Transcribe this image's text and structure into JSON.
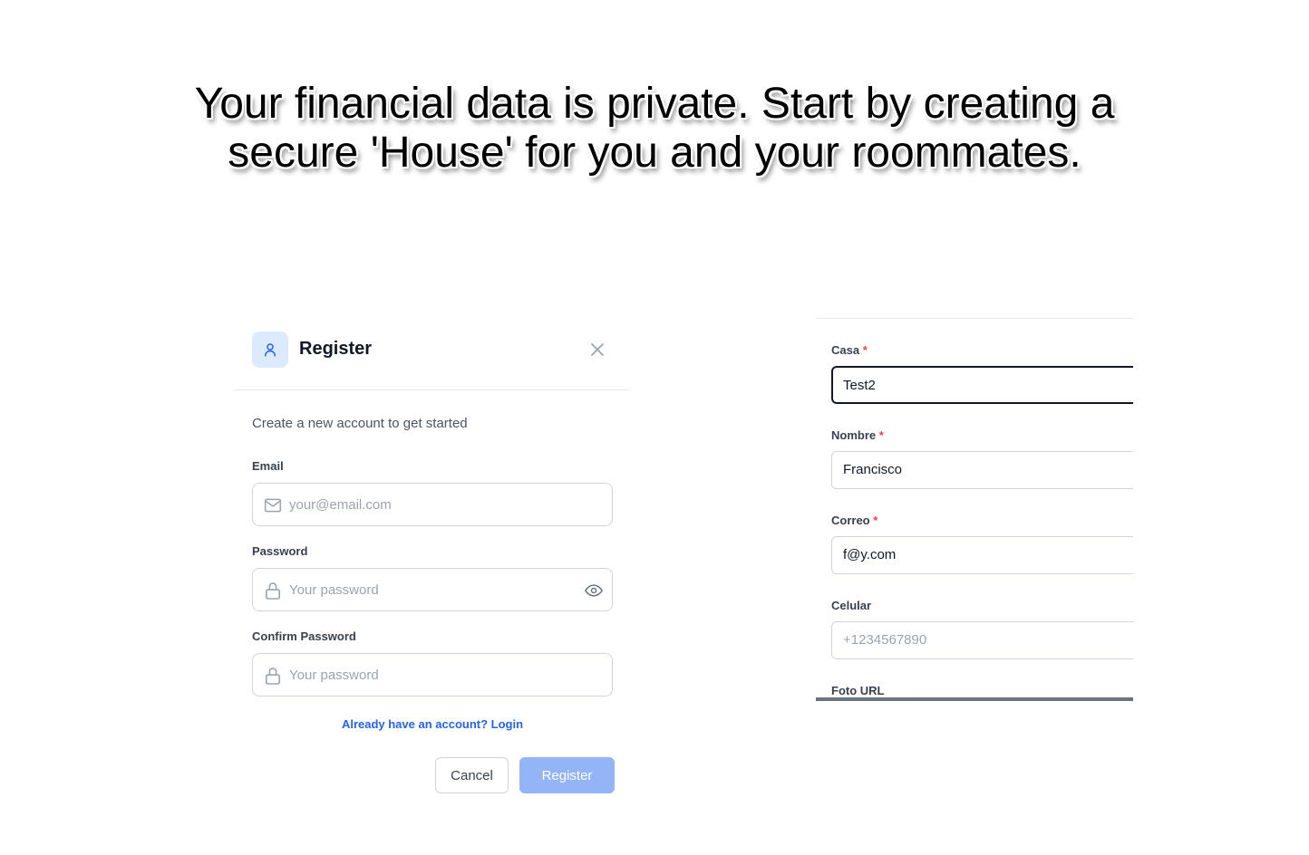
{
  "headline": {
    "line1": "Your financial data is private. Start by creating a",
    "line2": "secure 'House' for you and your roommates."
  },
  "register": {
    "title": "Register",
    "subtitle": "Create a new account to get started",
    "email_label": "Email",
    "email_placeholder": "your@email.com",
    "password_label": "Password",
    "password_placeholder": "Your password",
    "confirm_label": "Confirm Password",
    "confirm_placeholder": "Your password",
    "login_link": "Already have an account? Login",
    "cancel_label": "Cancel",
    "register_label": "Register"
  },
  "profile": {
    "casa_label": "Casa",
    "casa_value": "Test2",
    "nombre_label": "Nombre",
    "nombre_value": "Francisco",
    "correo_label": "Correo",
    "correo_value": "f@y.com",
    "celular_label": "Celular",
    "celular_placeholder": "+1234567890",
    "foto_label": "Foto URL",
    "required_mark": "*"
  },
  "colors": {
    "accent": "#2563eb",
    "register_button": "#93b4f7",
    "required": "#ef4444",
    "avatar_bg": "#dbeafe"
  },
  "icons": [
    "user-icon",
    "close-icon",
    "mail-icon",
    "lock-icon",
    "eye-icon"
  ]
}
